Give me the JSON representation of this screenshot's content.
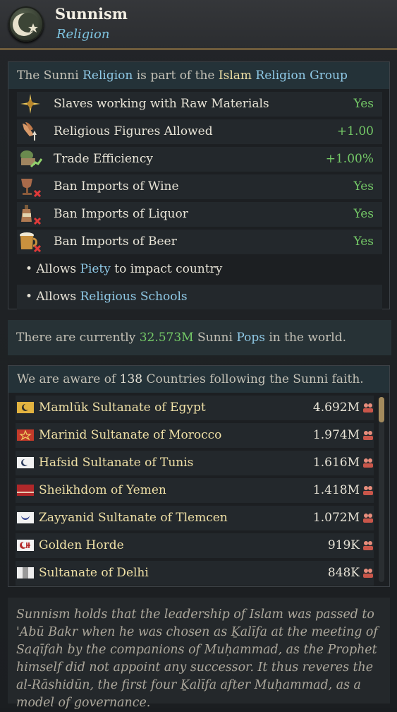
{
  "header": {
    "title": "Sunnism",
    "subtitle": "Religion"
  },
  "intro": {
    "part1": "The Sunni ",
    "religion_link": "Religion",
    "part2": " is part of the ",
    "group_name": "Islam",
    "space": " ",
    "group_link": "Religion Group"
  },
  "modifiers": [
    {
      "label": "Slaves working with Raw Materials",
      "value": "Yes",
      "icon": "compass-star-icon"
    },
    {
      "label": "Religious Figures Allowed",
      "value": "+1.00",
      "icon": "praying-hands-icon"
    },
    {
      "label": "Trade Efficiency",
      "value": "+1.00%",
      "icon": "trade-goods-icon"
    },
    {
      "label": "Ban Imports of Wine",
      "value": "Yes",
      "icon": "wine-ban-icon"
    },
    {
      "label": "Ban Imports of Liquor",
      "value": "Yes",
      "icon": "liquor-ban-icon"
    },
    {
      "label": "Ban Imports of Beer",
      "value": "Yes",
      "icon": "beer-ban-icon"
    }
  ],
  "bullets": {
    "piety": {
      "prefix": "• Allows ",
      "link": "Piety",
      "suffix": " to impact country"
    },
    "schools": {
      "prefix": "• Allows ",
      "link": "Religious Schools"
    }
  },
  "pops": {
    "prefix": "There are currently ",
    "value": "32.573M",
    "mid": " Sunni ",
    "link": "Pops",
    "suffix": " in the world."
  },
  "countries_header": {
    "prefix": "We are aware of ",
    "count": "138",
    "suffix": " Countries following the Sunni faith."
  },
  "countries": [
    {
      "name": "Mamlūk Sultanate of Egypt",
      "pops": "4.692M"
    },
    {
      "name": "Marinid Sultanate of Morocco",
      "pops": "1.974M"
    },
    {
      "name": "Hafsid Sultanate of Tunis",
      "pops": "1.616M"
    },
    {
      "name": "Sheikhdom of Yemen",
      "pops": "1.418M"
    },
    {
      "name": "Zayyanid Sultanate of Tlemcen",
      "pops": "1.072M"
    },
    {
      "name": "Golden Horde",
      "pops": "919K"
    },
    {
      "name": "Sultanate of Delhi",
      "pops": "848K"
    }
  ],
  "lore": "Sunnism holds that the leadership of Islam was passed to 'Abū Bakr when he was chosen as Ḵalīfa at the meeting of Saqīfah by the companions of Muḥammad, as the Prophet himself did not appoint any successor. It thus reveres the al-Rāshidūn, the first four Ḵalīfa after Muḥammad, as a model of governance.",
  "colors": {
    "accent_blue": "#8fc9e6",
    "positive_green": "#74c967",
    "gold_text": "#efe0a6",
    "header_border": "#6e5b3c"
  },
  "icons": {
    "emblem": "crescent-star-icon",
    "pop": "pop-people-icon"
  }
}
